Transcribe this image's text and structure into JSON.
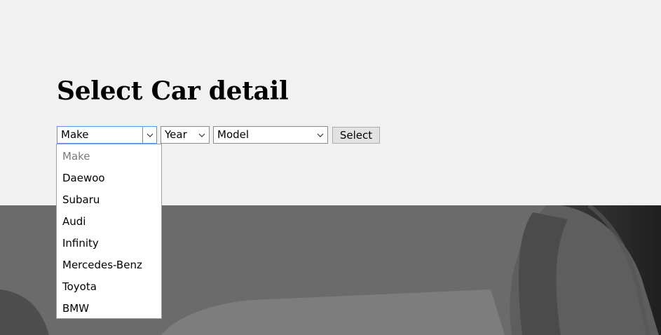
{
  "page": {
    "title": "Select Car detail"
  },
  "form": {
    "make": {
      "value": "Make"
    },
    "year": {
      "value": "Year"
    },
    "model": {
      "value": "Model"
    },
    "submit_label": "Select"
  },
  "make_dropdown": {
    "options": [
      {
        "label": "Make"
      },
      {
        "label": "Daewoo"
      },
      {
        "label": "Subaru"
      },
      {
        "label": "Audi"
      },
      {
        "label": "Infinity"
      },
      {
        "label": "Mercedes-Benz"
      },
      {
        "label": "Toyota"
      },
      {
        "label": "BMW"
      }
    ]
  },
  "icons": {
    "chevron": "chevron-down-icon"
  },
  "colors": {
    "background": "#f1f1f1",
    "focus_border": "#5a93d6",
    "hero": "#5e5f5e"
  }
}
